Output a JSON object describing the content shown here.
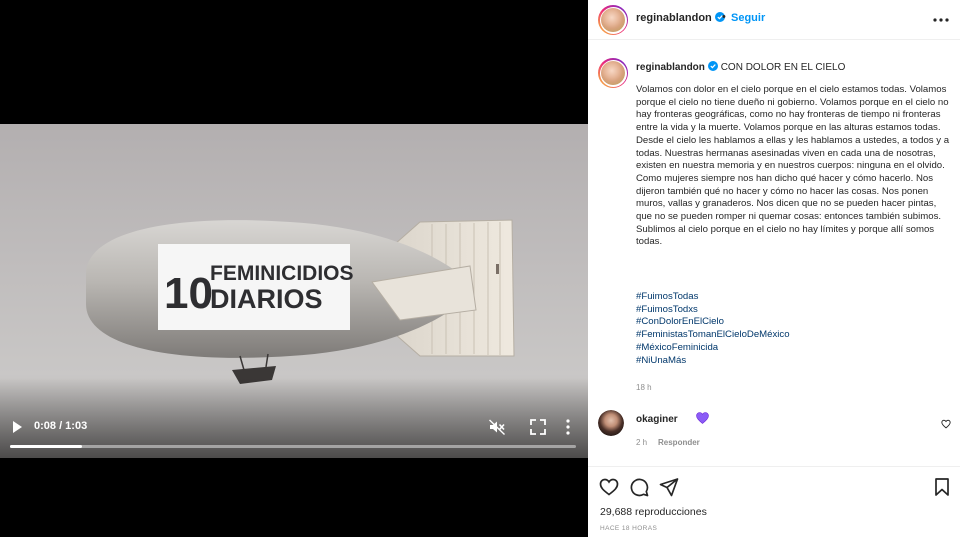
{
  "video": {
    "banner_number": "10",
    "banner_line1": "FEMINICIDIOS",
    "banner_line2": "DIARIOS",
    "time_display": "0:08 / 1:03",
    "progress_fraction": 0.127
  },
  "header": {
    "username": "reginablandon",
    "separator": "•",
    "follow_label": "Seguir"
  },
  "caption": {
    "username": "reginablandon",
    "title": "CON DOLOR EN EL CIELO",
    "body": "Volamos con dolor en el cielo porque en el cielo estamos todas. Volamos porque el cielo no tiene dueño ni gobierno. Volamos porque en el cielo no hay fronteras geográficas, como no hay fronteras de tiempo ni fronteras entre la vida y la muerte. Volamos porque en las alturas estamos todas. Desde el cielo les hablamos a ellas y les hablamos a ustedes, a todos y a todas. Nuestras hermanas asesinadas viven en cada una de nosotras, existen en nuestra memoria y en nuestros cuerpos: ninguna en el olvido. Como mujeres siempre nos han dicho qué hacer y cómo hacerlo. Nos dijeron también qué no hacer y cómo no hacer las cosas. Nos ponen muros, vallas y granaderos. Nos dicen que no se pueden hacer pintas, que no se pueden romper ni quemar cosas: entonces también subimos. Sublimos al cielo porque en el cielo no hay límites y porque allí somos todas.",
    "hashtags": [
      "#FuimosTodas",
      "#FuimosTodxs",
      "#ConDolorEnElCielo",
      "#FeministasTomanElCieloDeMéxico",
      "#MéxicoFeminicida",
      "#NiUnaMás"
    ],
    "time": "18 h"
  },
  "comment": {
    "username": "okaginer",
    "emoji": "purple-heart",
    "time": "2 h",
    "reply_label": "Responder"
  },
  "actions": {
    "views": "29,688 reproducciones",
    "post_age": "HACE 18 HORAS"
  },
  "colors": {
    "link": "#0095f6",
    "hashtag": "#00376b",
    "verified": "#0095f6",
    "emoji_heart": "#8b5cf6"
  }
}
